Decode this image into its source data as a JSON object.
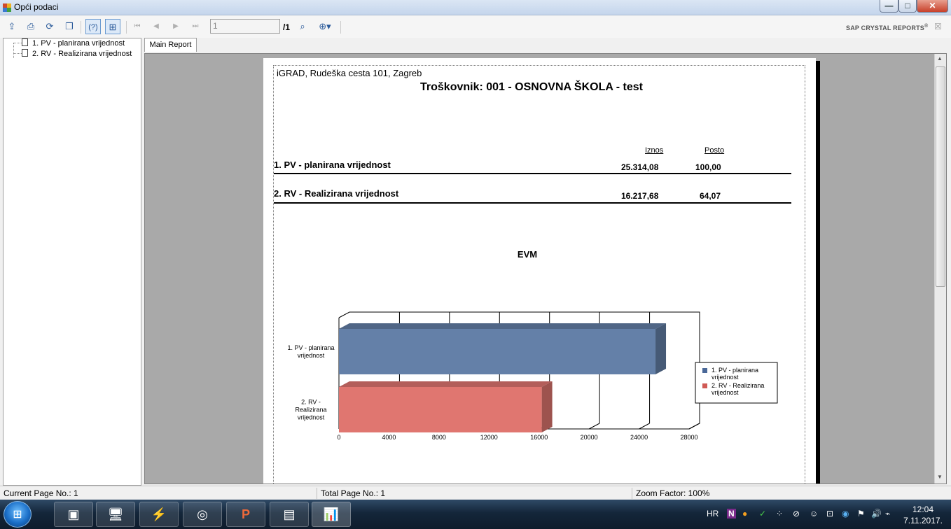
{
  "window": {
    "title": "Opći podaci",
    "controls": [
      "—",
      "□",
      "✕"
    ]
  },
  "toolbar": {
    "page_input": "1",
    "page_total": "/1",
    "brand": "SAP CRYSTAL REPORTS",
    "brand_mark": "®",
    "close_panel": "☒",
    "icons": [
      "export-icon",
      "print-icon",
      "refresh-icon",
      "copy-icon",
      "help-icon",
      "group-tree-icon",
      "first-page-icon",
      "prev-page-icon",
      "next-page-icon",
      "last-page-icon",
      "find-icon",
      "zoom-icon"
    ]
  },
  "tree": {
    "items": [
      "1. PV - planirana vrijednost",
      "2. RV - Realizirana vrijednost"
    ]
  },
  "tabs": {
    "main": "Main Report"
  },
  "report": {
    "company": "iGRAD, Rudeška cesta 101, Zagreb",
    "title": "Troškovnik: 001 - OSNOVNA ŠKOLA - test",
    "col_iznos": "Iznos",
    "col_posto": "Posto",
    "rows": [
      {
        "label": "1. PV - planirana vrijednost",
        "iznos": "25.314,08",
        "posto": "100,00"
      },
      {
        "label": "2. RV - Realizirana vrijednost",
        "iznos": "16.217,68",
        "posto": "64,07"
      }
    ]
  },
  "chart_data": {
    "type": "bar",
    "orientation": "horizontal",
    "title": "EVM",
    "categories": [
      "1. PV - planirana vrijednost",
      "2. RV - Realizirana vrijednost"
    ],
    "category_labels": [
      [
        "1. PV - planirana",
        "vrijednost"
      ],
      [
        "2. RV -",
        "Realizirana",
        "vrijednost"
      ]
    ],
    "values": [
      25314.08,
      16217.68
    ],
    "colors": [
      "#6480a8",
      "#e07670"
    ],
    "xlim": [
      0,
      28000
    ],
    "xticks": [
      "0",
      "4000",
      "8000",
      "12000",
      "16000",
      "20000",
      "24000",
      "28000"
    ],
    "legend": [
      {
        "lines": [
          "1. PV - planirana",
          "vrijednost"
        ],
        "color": "#4a6898"
      },
      {
        "lines": [
          "2. RV - Realizirana",
          "vrijednost"
        ],
        "color": "#d05a55"
      }
    ],
    "legend_position": "right",
    "grid": true
  },
  "status": {
    "current_page": "Current Page No.: 1",
    "total_page": "Total Page No.: 1",
    "zoom": "Zoom Factor: 100%"
  },
  "taskbar": {
    "start": "⊞",
    "apps": [
      "▣",
      "🖥",
      "⚡",
      "◎",
      "P",
      "▤",
      "📊"
    ],
    "lang": "HR",
    "tray_icons": [
      "N",
      "●",
      "✓",
      "⁘",
      "⊘",
      "☺",
      "⊡",
      "◉",
      "⚑",
      "🔊",
      "⌁"
    ],
    "time": "12:04",
    "date": "7.11.2017."
  }
}
